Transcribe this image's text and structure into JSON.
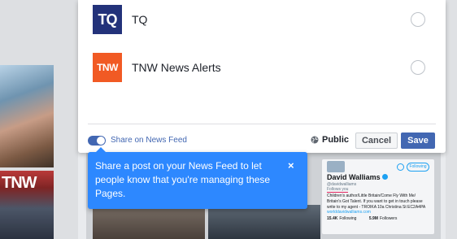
{
  "pages": [
    {
      "logo_text": "TQ",
      "name": "TQ",
      "selected": false
    },
    {
      "logo_text": "TNW",
      "name": "TNW News Alerts",
      "selected": false
    }
  ],
  "share_toggle": {
    "label": "Share on News Feed",
    "on": true
  },
  "privacy": {
    "label": "Public",
    "icon": "globe-icon"
  },
  "buttons": {
    "cancel": "Cancel",
    "save": "Save"
  },
  "tooltip": {
    "text": "Share a post on your News Feed to let people know that you're managing these Pages.",
    "close": "×"
  },
  "background": {
    "left_photo_logo": "TNW",
    "twitter_card": {
      "name": "David Walliams",
      "handle": "@davidwalliams",
      "follows_you": "Follows you",
      "bio": "Children's author/Little Britain/Come Fly With Me/ Britain's Got Talent. If you want to get in touch please write to my agent - TROIKA 10a Christina St EC2A4PA",
      "link": "worlddavidwalliams.com",
      "following_label": "Following",
      "stats": [
        {
          "value": "15.4K",
          "label": "Following"
        },
        {
          "value": "5.9M",
          "label": "Followers"
        }
      ]
    }
  },
  "colors": {
    "brand": "#4267b2",
    "tooltip": "#2d88ff",
    "tq_logo": "#23327a",
    "tnw_logo": "#f15a24"
  }
}
